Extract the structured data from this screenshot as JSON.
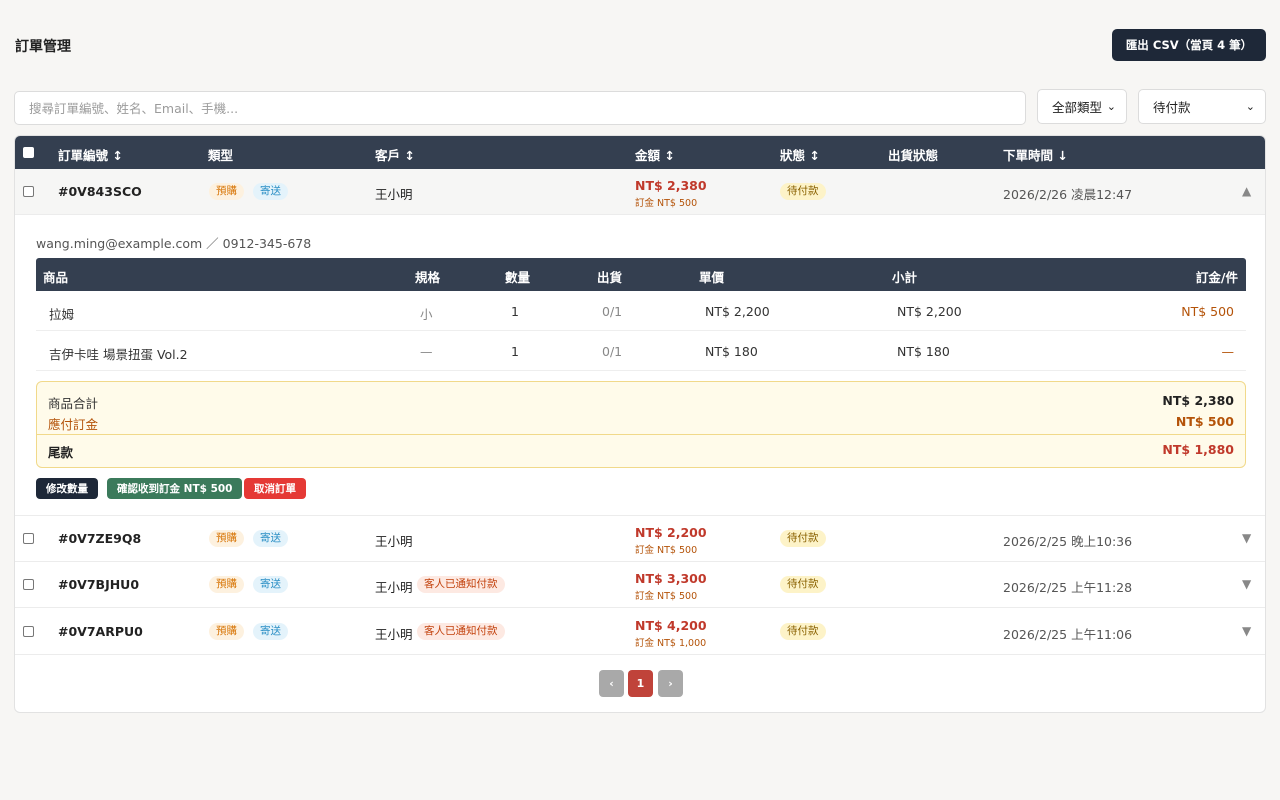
{
  "header": {
    "title": "訂單管理",
    "export_label": "匯出 CSV（當頁 4 筆）"
  },
  "filters": {
    "search_placeholder": "搜尋訂單編號、姓名、Email、手機...",
    "type_value": "全部類型",
    "status_value": "待付款"
  },
  "columns": {
    "order_no": "訂單編號 ↕",
    "type": "類型",
    "customer": "客戶 ↕",
    "amount": "金額 ↕",
    "status": "狀態 ↕",
    "shipping": "出貨狀態",
    "time": "下單時間 ↓"
  },
  "orders": [
    {
      "id": "#0V843SCO",
      "tag1": "預購",
      "tag2": "寄送",
      "customer": "王小明",
      "notice": "",
      "amount": "NT$ 2,380",
      "deposit": "訂金 NT$ 500",
      "status": "待付款",
      "time": "2026/2/26 凌晨12:47",
      "toggle": "▲"
    },
    {
      "id": "#0V7ZE9Q8",
      "tag1": "預購",
      "tag2": "寄送",
      "customer": "王小明",
      "notice": "",
      "amount": "NT$ 2,200",
      "deposit": "訂金 NT$ 500",
      "status": "待付款",
      "time": "2026/2/25 晚上10:36",
      "toggle": "▼"
    },
    {
      "id": "#0V7BJHU0",
      "tag1": "預購",
      "tag2": "寄送",
      "customer": "王小明",
      "notice": "客人已通知付款",
      "amount": "NT$ 3,300",
      "deposit": "訂金 NT$ 500",
      "status": "待付款",
      "time": "2026/2/25 上午11:28",
      "toggle": "▼"
    },
    {
      "id": "#0V7ARPU0",
      "tag1": "預購",
      "tag2": "寄送",
      "customer": "王小明",
      "notice": "客人已通知付款",
      "amount": "NT$ 4,200",
      "deposit": "訂金 NT$ 1,000",
      "status": "待付款",
      "time": "2026/2/25 上午11:06",
      "toggle": "▼"
    }
  ],
  "detail": {
    "contact": "wang.ming@example.com ／ 0912-345-678",
    "item_columns": {
      "product": "商品",
      "spec": "規格",
      "qty": "數量",
      "shipped": "出貨",
      "unit": "單價",
      "subtotal": "小計",
      "deposit": "訂金/件"
    },
    "items": [
      {
        "product": "拉姆",
        "spec": "小",
        "qty": "1",
        "shipped": "0/1",
        "unit": "NT$ 2,200",
        "subtotal": "NT$ 2,200",
        "deposit": "NT$ 500"
      },
      {
        "product": "吉伊卡哇 場景扭蛋 Vol.2",
        "spec": "—",
        "qty": "1",
        "shipped": "0/1",
        "unit": "NT$ 180",
        "subtotal": "NT$ 180",
        "deposit": "—"
      }
    ],
    "summary": {
      "goods_label": "商品合計",
      "goods_value": "NT$ 2,380",
      "deposit_label": "應付訂金",
      "deposit_value": "NT$ 500",
      "balance_label": "尾款",
      "balance_value": "NT$ 1,880"
    },
    "actions": {
      "edit": "修改數量",
      "confirm": "確認收到訂金 NT$ 500",
      "cancel": "取消訂單"
    }
  },
  "pagination": {
    "prev": "‹",
    "current": "1",
    "next": "›"
  },
  "colors": {
    "header_bg": "#343f50",
    "primary_dark": "#1e2838",
    "amount_red": "#c0392b",
    "confirm_green": "#3b7a5b",
    "cancel_red": "#e53935"
  }
}
